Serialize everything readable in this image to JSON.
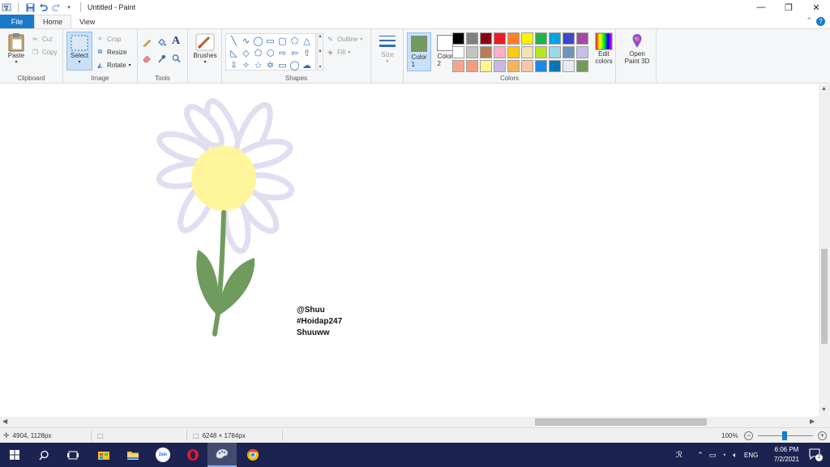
{
  "window": {
    "title": "Untitled - Paint",
    "controls": {
      "minimize": "—",
      "restore": "❐",
      "close": "✕"
    }
  },
  "ribbon_tabs": [
    {
      "label": "File"
    },
    {
      "label": "Home"
    },
    {
      "label": "View"
    }
  ],
  "clipboard": {
    "paste": "Paste",
    "cut": "Cut",
    "copy": "Copy",
    "group": "Clipboard"
  },
  "image": {
    "select": "Select",
    "crop": "Crop",
    "resize": "Resize",
    "rotate": "Rotate",
    "group": "Image"
  },
  "tools": {
    "group": "Tools",
    "text_glyph": "A"
  },
  "brushes": {
    "label": "Brushes"
  },
  "shapes": {
    "outline": "Outline",
    "fill": "Fill",
    "group": "Shapes"
  },
  "size": {
    "label": "Size"
  },
  "colors": {
    "color1_label": "Color\n1",
    "color2_label": "Color\n2",
    "color1": "#6f9c5e",
    "color2": "#ffffff",
    "edit_label": "Edit\ncolors",
    "group": "Colors",
    "palette": [
      "#000000",
      "#7f7f7f",
      "#880015",
      "#ed1c24",
      "#ff7f27",
      "#fff200",
      "#22b14c",
      "#00a2e8",
      "#3f48cc",
      "#a349a4",
      "#ffffff",
      "#c3c3c3",
      "#b97a57",
      "#ffaec9",
      "#ffc90e",
      "#efe4b0",
      "#b5e61d",
      "#99d9ea",
      "#7092be",
      "#c8bfe7",
      "#f7a58a",
      "#f79a7a",
      "#fff68f",
      "#c9b8e0",
      "#f5b45c",
      "#f7c6a5",
      "#1e88e5",
      "#0277bd",
      "#e8e8f4",
      "#6f9c5e"
    ]
  },
  "paint3d": {
    "label": "Open\nPaint 3D"
  },
  "canvas_text": [
    "@Shuu",
    "#Hoidap247",
    "Shuuww"
  ],
  "drawing": {
    "petal_color": "#e6e3f3",
    "center_color": "#fff59a",
    "stem_color": "#6f9c5e"
  },
  "status": {
    "cursor_pos": "4904, 1128px",
    "canvas_size": "6248 × 1784px",
    "zoom": "100%"
  },
  "taskbar": {
    "time": "6:06 PM",
    "date": "7/2/2021",
    "lang": "ENG",
    "zalo_label": "Zalo",
    "notif_count": "2"
  }
}
